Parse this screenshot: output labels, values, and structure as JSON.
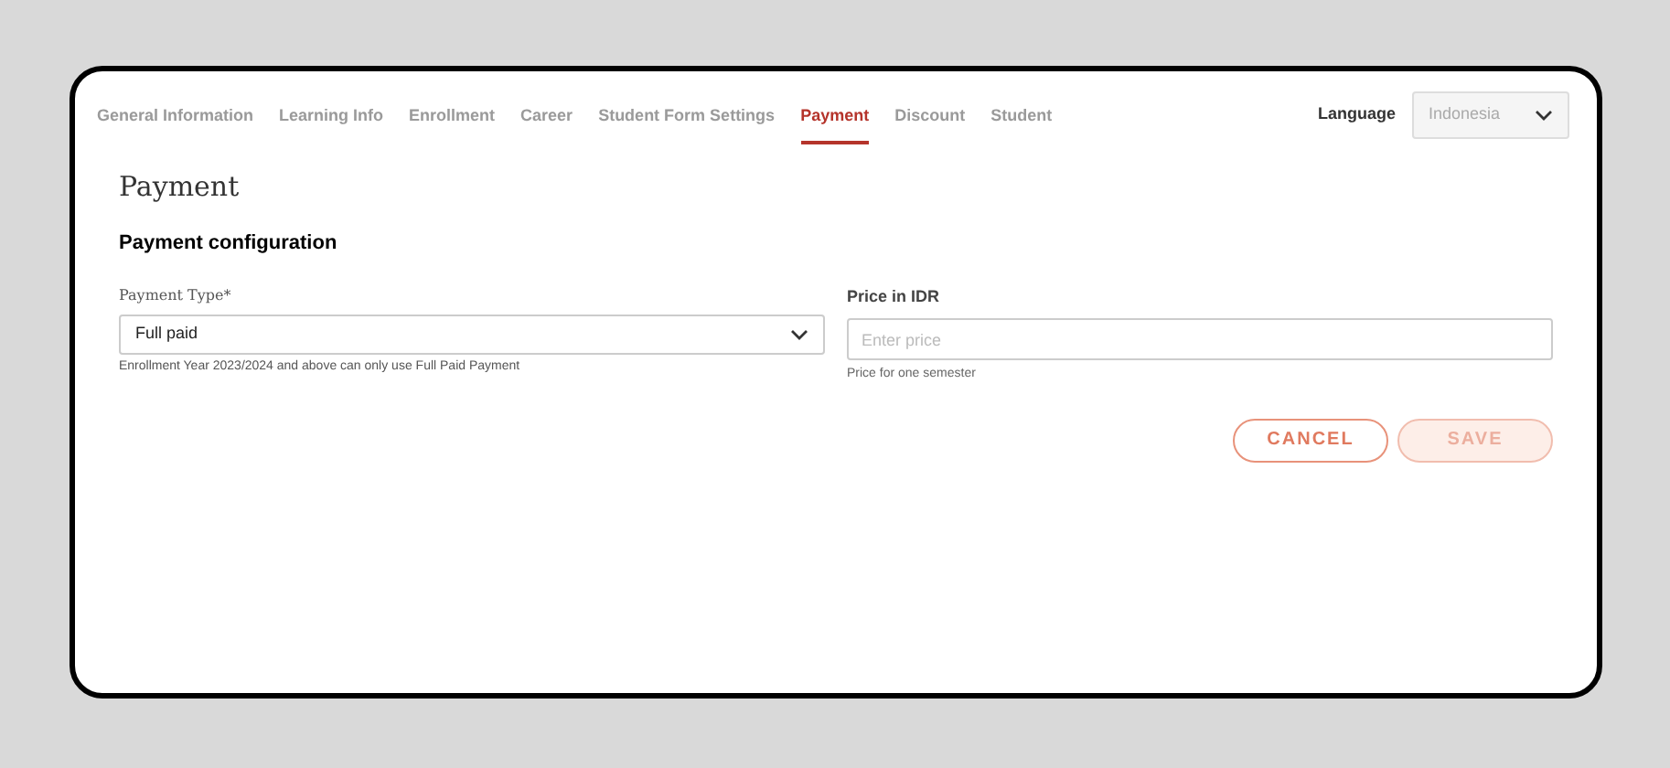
{
  "tabs": [
    {
      "label": "General Information",
      "selected": false
    },
    {
      "label": "Learning Info",
      "selected": false
    },
    {
      "label": "Enrollment",
      "selected": false
    },
    {
      "label": "Career",
      "selected": false
    },
    {
      "label": "Student Form Settings",
      "selected": false
    },
    {
      "label": "Payment",
      "selected": true
    },
    {
      "label": "Discount",
      "selected": false
    },
    {
      "label": "Student",
      "selected": false
    }
  ],
  "language": {
    "label": "Language",
    "value": "Indonesia"
  },
  "title": "Payment",
  "section_title": "Payment configuration",
  "payment_type": {
    "label": "Payment Type*",
    "value": "Full paid",
    "help": "Enrollment Year 2023/2024 and above can only use Full Paid Payment"
  },
  "price": {
    "label": "Price in IDR",
    "placeholder": "Enter price",
    "help": "Price for one semester"
  },
  "buttons": [
    {
      "label": "CANCEL",
      "kind": "outline",
      "disabled": false
    },
    {
      "label": "SAVE",
      "kind": "filled",
      "disabled": true
    }
  ]
}
